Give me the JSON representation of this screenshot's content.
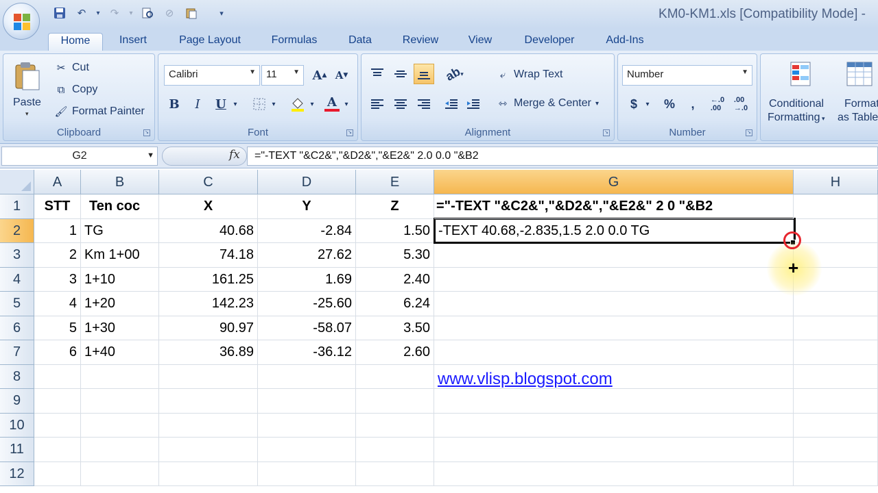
{
  "window": {
    "title": "KM0-KM1.xls  [Compatibility Mode] -"
  },
  "tabs": [
    "Home",
    "Insert",
    "Page Layout",
    "Formulas",
    "Data",
    "Review",
    "View",
    "Developer",
    "Add-Ins"
  ],
  "clipboard": {
    "paste": "Paste",
    "cut": "Cut",
    "copy": "Copy",
    "format_painter": "Format Painter",
    "label": "Clipboard"
  },
  "font": {
    "name": "Calibri",
    "size": "11",
    "label": "Font",
    "bold": "B",
    "italic": "I",
    "underline": "U",
    "grow": "A",
    "shrink": "A",
    "color_a": "A"
  },
  "alignment": {
    "wrap": "Wrap Text",
    "merge": "Merge & Center",
    "label": "Alignment"
  },
  "number": {
    "format": "Number",
    "label": "Number",
    "currency": "$",
    "percent": "%",
    "comma": ",",
    "inc_dec": ".0→.00",
    "dec_dec": ".00→.0"
  },
  "styles": {
    "conditional": "Conditional",
    "formatting": "Formatting",
    "format_as": "Format",
    "as_table": "as Table"
  },
  "formula_bar": {
    "name_box": "G2",
    "fx": "fx",
    "formula": "=\"-TEXT \"&C2&\",\"&D2&\",\"&E2&\" 2.0 0.0 \"&B2"
  },
  "columns": [
    "A",
    "B",
    "C",
    "D",
    "E",
    "G",
    "H"
  ],
  "rows": [
    "1",
    "2",
    "3",
    "4",
    "5",
    "6",
    "7",
    "8",
    "9",
    "10",
    "11",
    "12"
  ],
  "header_row": {
    "a": "STT",
    "b": "Ten coc",
    "c": "X",
    "d": "Y",
    "e": "Z",
    "g": "=\"-TEXT \"&C2&\",\"&D2&\",\"&E2&\" 2 0 \"&B2"
  },
  "data_rows": [
    {
      "stt": "1",
      "ten": "TG",
      "x": "40.68",
      "y": "-2.84",
      "z": "1.50"
    },
    {
      "stt": "2",
      "ten": "Km 1+00",
      "x": "74.18",
      "y": "27.62",
      "z": "5.30"
    },
    {
      "stt": "3",
      "ten": "1+10",
      "x": "161.25",
      "y": "1.69",
      "z": "2.40"
    },
    {
      "stt": "4",
      "ten": "1+20",
      "x": "142.23",
      "y": "-25.60",
      "z": "6.24"
    },
    {
      "stt": "5",
      "ten": "1+30",
      "x": "90.97",
      "y": "-58.07",
      "z": "3.50"
    },
    {
      "stt": "6",
      "ten": "1+40",
      "x": "36.89",
      "y": "-36.12",
      "z": "2.60"
    }
  ],
  "g2_value": "-TEXT 40.68,-2.835,1.5 2.0 0.0 TG",
  "link": "www.vlisp.blogspot.com",
  "colors": {
    "selected_header": "#f5b750",
    "link": "#1a1aff",
    "ribbon": "#dbe7f6"
  }
}
